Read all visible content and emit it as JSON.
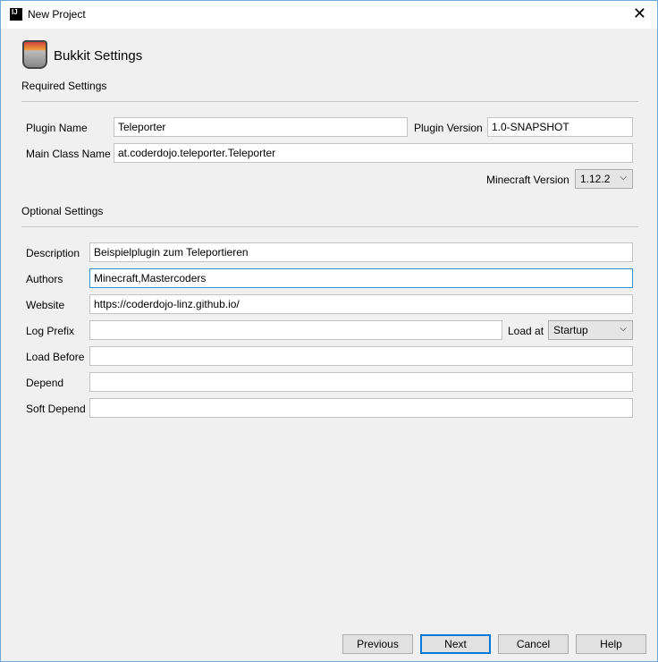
{
  "window": {
    "title": "New Project",
    "close_icon": "close-icon"
  },
  "header": {
    "title": "Bukkit Settings"
  },
  "required": {
    "title": "Required Settings",
    "plugin_name_label": "Plugin Name",
    "plugin_name": "Teleporter",
    "plugin_version_label": "Plugin Version",
    "plugin_version": "1.0-SNAPSHOT",
    "main_class_label": "Main Class Name",
    "main_class": "at.coderdojo.teleporter.Teleporter",
    "mc_version_label": "Minecraft Version",
    "mc_version": "1.12.2"
  },
  "optional": {
    "title": "Optional Settings",
    "description_label": "Description",
    "description": "Beispielplugin zum Teleportieren",
    "authors_label": "Authors",
    "authors": "Minecraft,Mastercoders",
    "website_label": "Website",
    "website": "https://coderdojo-linz.github.io/",
    "log_prefix_label": "Log Prefix",
    "log_prefix": "",
    "load_at_label": "Load at",
    "load_at": "Startup",
    "load_before_label": "Load Before",
    "load_before": "",
    "depend_label": "Depend",
    "depend": "",
    "soft_depend_label": "Soft Depend",
    "soft_depend": ""
  },
  "buttons": {
    "previous": "Previous",
    "next": "Next",
    "cancel": "Cancel",
    "help": "Help"
  }
}
